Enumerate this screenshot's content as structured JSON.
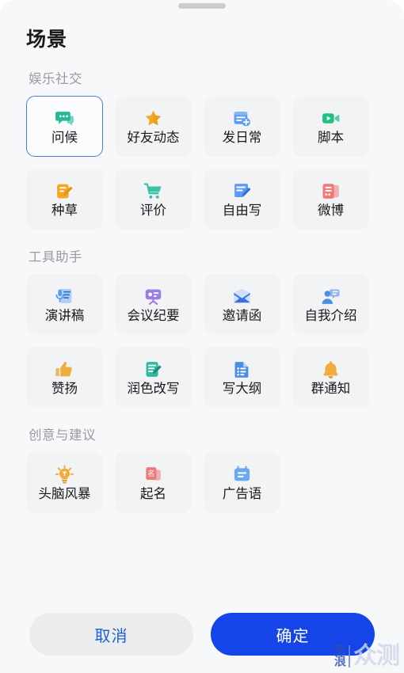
{
  "sheet": {
    "title": "场景",
    "drag_handle": "drag-handle"
  },
  "sections": [
    {
      "title": "娱乐社交",
      "items": [
        {
          "label": "问候",
          "icon": "chat-bubble-icon",
          "color": "#25b896",
          "selected": true
        },
        {
          "label": "好友动态",
          "icon": "star-icon",
          "color": "#f5a623",
          "selected": false
        },
        {
          "label": "发日常",
          "icon": "calendar-plus-icon",
          "color": "#5b9bf3",
          "selected": false
        },
        {
          "label": "脚本",
          "icon": "video-camera-icon",
          "color": "#20c081",
          "selected": false
        },
        {
          "label": "种草",
          "icon": "note-pencil-icon",
          "color": "#f5a623",
          "selected": false
        },
        {
          "label": "评价",
          "icon": "shopping-cart-icon",
          "color": "#3dc0a8",
          "selected": false
        },
        {
          "label": "自由写",
          "icon": "write-pen-icon",
          "color": "#5b9bf3",
          "selected": false
        },
        {
          "label": "微博",
          "icon": "weibo-card-icon",
          "color": "#f07a7a",
          "selected": false
        }
      ]
    },
    {
      "title": "工具助手",
      "items": [
        {
          "label": "演讲稿",
          "icon": "microphone-scroll-icon",
          "color": "#5b9bf3",
          "selected": false
        },
        {
          "label": "会议纪要",
          "icon": "presentation-icon",
          "color": "#9b7ce8",
          "selected": false
        },
        {
          "label": "邀请函",
          "icon": "envelope-icon",
          "color": "#3b6fe0",
          "selected": false
        },
        {
          "label": "自我介绍",
          "icon": "person-speech-icon",
          "color": "#4a90e2",
          "selected": false
        },
        {
          "label": "赞扬",
          "icon": "thumbs-up-icon",
          "color": "#f0ad3e",
          "selected": false
        },
        {
          "label": "润色改写",
          "icon": "document-edit-icon",
          "color": "#2fb9a0",
          "selected": false
        },
        {
          "label": "写大纲",
          "icon": "outline-list-icon",
          "color": "#4a90e2",
          "selected": false
        },
        {
          "label": "群通知",
          "icon": "bell-icon",
          "color": "#f0ad3e",
          "selected": false
        }
      ]
    },
    {
      "title": "创意与建议",
      "items": [
        {
          "label": "头脑风暴",
          "icon": "lightbulb-icon",
          "color": "#f0ad3e",
          "selected": false
        },
        {
          "label": "起名",
          "icon": "name-card-icon",
          "color": "#f07a7a",
          "selected": false
        },
        {
          "label": "广告语",
          "icon": "ad-board-icon",
          "color": "#69a9f0",
          "selected": false
        }
      ]
    }
  ],
  "footer": {
    "cancel_label": "取消",
    "confirm_label": "确定"
  },
  "watermark": {
    "brand_small_line1": "新",
    "brand_small_line2": "浪",
    "brand_big": "众测"
  },
  "colors": {
    "accent": "#1544e8",
    "selected_border": "#4a7fd4",
    "cancel_text": "#1f5fd0",
    "card_bg": "#f2f3f5",
    "page_bg": "#f7f8fa",
    "section_title": "#9a9ba0"
  }
}
